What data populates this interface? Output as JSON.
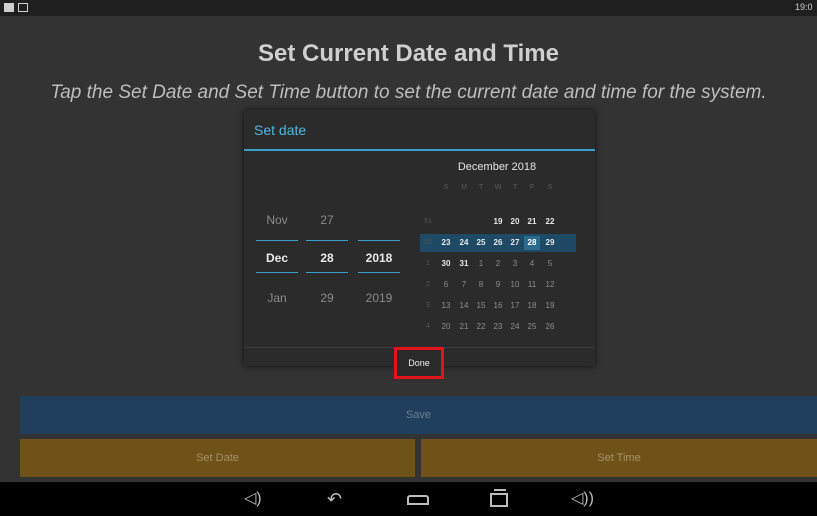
{
  "status_bar": {
    "time": "19:0"
  },
  "header": {
    "title": "Set Current Date and Time",
    "subtitle": "Tap the Set Date and Set Time button to set the current date and time for the system."
  },
  "dialog": {
    "title": "Set date",
    "picker": {
      "month": {
        "prev": "Nov",
        "current": "Dec",
        "next": "Jan"
      },
      "day": {
        "prev": "27",
        "current": "28",
        "next": "29"
      },
      "year": {
        "current": "2018",
        "next": "2019"
      }
    },
    "calendar": {
      "month_label": "December 2018",
      "weekday_labels": [
        "S",
        "M",
        "T",
        "W",
        "T",
        "F",
        "S"
      ],
      "week_numbers": [
        "51",
        "52",
        "1",
        "2",
        "3",
        "4"
      ],
      "rows": [
        [
          "",
          "",
          "",
          "19",
          "20",
          "21",
          "22"
        ],
        [
          "23",
          "24",
          "25",
          "26",
          "27",
          "28",
          "29"
        ],
        [
          "30",
          "31",
          "1",
          "2",
          "3",
          "4",
          "5"
        ],
        [
          "6",
          "7",
          "8",
          "9",
          "10",
          "11",
          "12"
        ],
        [
          "13",
          "14",
          "15",
          "16",
          "17",
          "18",
          "19"
        ],
        [
          "20",
          "21",
          "22",
          "23",
          "24",
          "25",
          "26"
        ]
      ],
      "selected_day": "28"
    },
    "done_label": "Done"
  },
  "buttons": {
    "save": "Save",
    "set_date": "Set Date",
    "set_time": "Set Time"
  },
  "nav": {
    "icons": [
      "volume-down-icon",
      "back-icon",
      "home-icon",
      "recent-apps-icon",
      "volume-up-icon"
    ]
  },
  "colors": {
    "accent": "#3aa0c8",
    "save_bar": "#1f3f5c",
    "action_buttons": "#6e5218",
    "done_highlight": "#e0141a"
  }
}
